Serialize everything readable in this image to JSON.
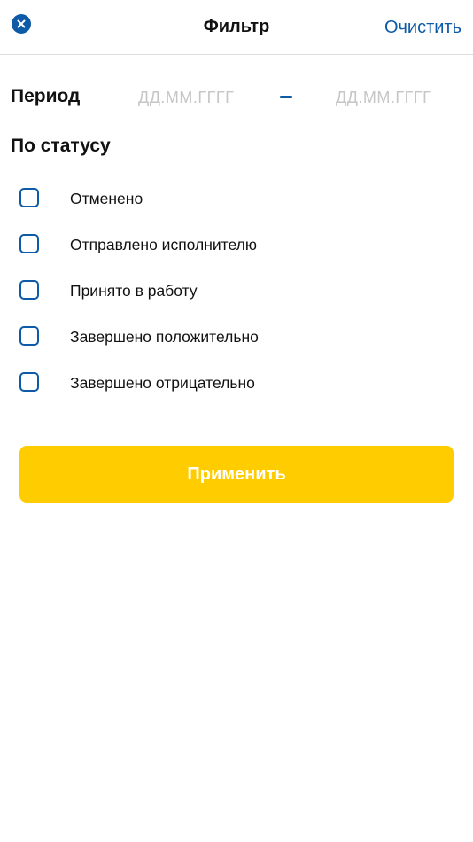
{
  "header": {
    "title": "Фильтр",
    "clear_label": "Очистить",
    "close_icon": "close-circle-icon"
  },
  "period": {
    "label": "Период",
    "from_placeholder": "ДД.ММ.ГГГГ",
    "to_placeholder": "ДД.ММ.ГГГГ",
    "from_value": "",
    "to_value": ""
  },
  "status": {
    "label": "По статусу",
    "options": [
      {
        "label": "Отменено",
        "checked": false
      },
      {
        "label": "Отправлено исполнителю",
        "checked": false
      },
      {
        "label": "Принято в работу",
        "checked": false
      },
      {
        "label": "Завершено положительно",
        "checked": false
      },
      {
        "label": "Завершено отрицательно",
        "checked": false
      }
    ]
  },
  "apply_label": "Применить",
  "colors": {
    "accent": "#0d5aa7",
    "primary": "#ffcc00",
    "placeholder": "#c6c6c6",
    "divider": "#dcdcdc"
  }
}
